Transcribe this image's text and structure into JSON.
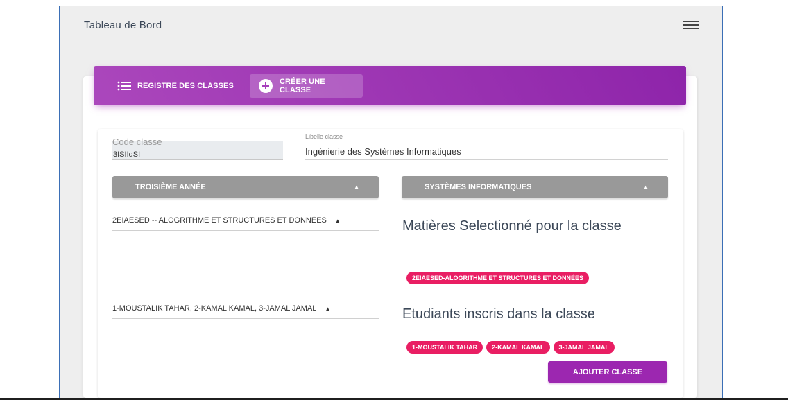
{
  "header": {
    "title": "Tableau de Bord",
    "menu_icon": "hamburger-menu-icon"
  },
  "tabs": [
    {
      "label": "REGISTRE DES CLASSES",
      "icon": "list-icon",
      "active": false
    },
    {
      "label": "CRÉER UNE CLASSE",
      "icon": "add-circle-icon",
      "active": true
    }
  ],
  "form": {
    "code_label": "Code classe",
    "code_value": "3ISIIdSI",
    "libelle_label": "Libelle classe",
    "libelle_value": "Ingénierie des Systèmes Informatiques",
    "niveau_select": "TROISIÈME ANNÉE",
    "filiere_select": "SYSTÈMES INFORMATIQUES",
    "matieres_picker": "2EIAESED -- ALOGRITHME ET STRUCTURES ET DONNÉES",
    "etudiants_picker": "1-MOUSTALIK TAHAR, 2-KAMAL KAMAL, 3-JAMAL JAMAL",
    "submit_label": "AJOUTER CLASSE"
  },
  "selected_matieres": {
    "title": "Matières Selectionné pour la classe",
    "chips": [
      "2EIAESED-ALOGRITHME ET STRUCTURES ET DONNÉES"
    ]
  },
  "enrolled_students": {
    "title": "Etudiants inscris dans la classe",
    "chips": [
      "1-MOUSTALIK TAHAR",
      "2-KAMAL KAMAL",
      "3-JAMAL JAMAL"
    ]
  },
  "colors": {
    "header_gradient_start": "#ab47bc",
    "header_gradient_end": "#8e24aa",
    "chip": "#e91e63",
    "primary_button": "#9c27b0",
    "select_button": "#999999"
  }
}
